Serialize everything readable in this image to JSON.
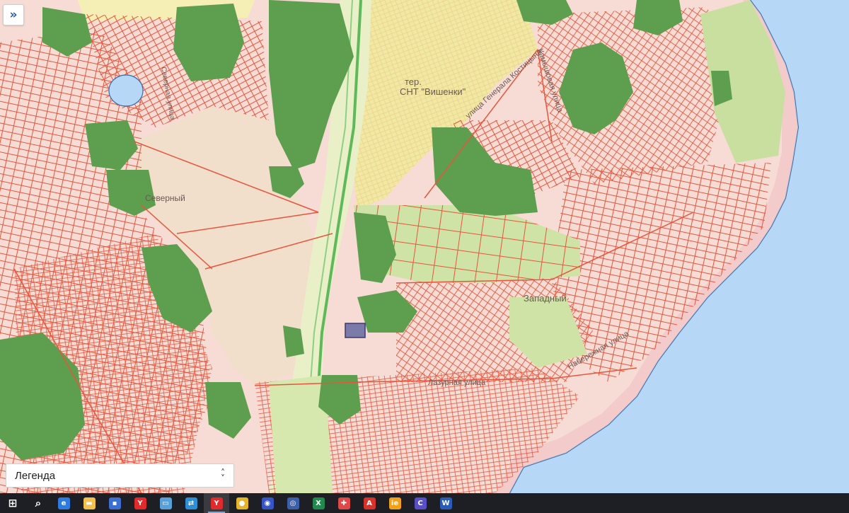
{
  "map": {
    "labels": {
      "snt_ter": "тер.",
      "snt_name": "СНТ \"Вишенки\"",
      "street_kostitsyna": "улица Генерала Костицына",
      "street_kamyshovaya": "Камышовая улица",
      "street_lazurnaya": "Лазурная улица",
      "street_naberezhnaya": "Набережная улица",
      "district_zapadny": "Западный",
      "district_severny": "Северный",
      "street_left_vertical": "Северная улица"
    },
    "colors": {
      "land": "#f6dcd4",
      "parcel_lines": "#e8553c",
      "forest": "#5e9e4f",
      "light_green": "#b9d88f",
      "yellow_snt": "#f0ea9e",
      "beige": "#f1decb",
      "water": "#b7d7f7",
      "coast": "#2f6fb3"
    }
  },
  "controls": {
    "expand_symbol": "»",
    "legend_label": "Легенда",
    "legend_chevron_up": "˄",
    "legend_chevron_down": "˅"
  },
  "taskbar": {
    "icons": [
      {
        "name": "windows-start",
        "glyph": "⊞",
        "color": "#ffffff"
      },
      {
        "name": "search",
        "glyph": "⌕",
        "color": "#ffffff"
      },
      {
        "name": "edge",
        "glyph": "e",
        "color": "#2d7be0"
      },
      {
        "name": "file-explorer",
        "glyph": "▬",
        "color": "#f2c14e"
      },
      {
        "name": "save-disk",
        "glyph": "▪",
        "color": "#3b6fd1"
      },
      {
        "name": "yandex",
        "glyph": "Y",
        "color": "#e22a2a"
      },
      {
        "name": "app-window",
        "glyph": "▭",
        "color": "#5aa0d8"
      },
      {
        "name": "teamviewer",
        "glyph": "⇄",
        "color": "#2e8fd8"
      },
      {
        "name": "yandex-browser",
        "glyph": "Y",
        "color": "#e22a2a"
      },
      {
        "name": "chrome",
        "glyph": "●",
        "color": "#e6b52a"
      },
      {
        "name": "app-blue-circle",
        "glyph": "◉",
        "color": "#3454c8"
      },
      {
        "name": "app-eye",
        "glyph": "◎",
        "color": "#3b5fa8"
      },
      {
        "name": "excel",
        "glyph": "X",
        "color": "#1f8a4c"
      },
      {
        "name": "app-red",
        "glyph": "✚",
        "color": "#e04848"
      },
      {
        "name": "acrobat",
        "glyph": "A",
        "color": "#d6332b"
      },
      {
        "name": "app-orange",
        "glyph": "ie",
        "color": "#f29f1a"
      },
      {
        "name": "app-c",
        "glyph": "C",
        "color": "#5b4ec9"
      },
      {
        "name": "word",
        "glyph": "W",
        "color": "#2b5bb8"
      }
    ],
    "active_index": 8
  }
}
